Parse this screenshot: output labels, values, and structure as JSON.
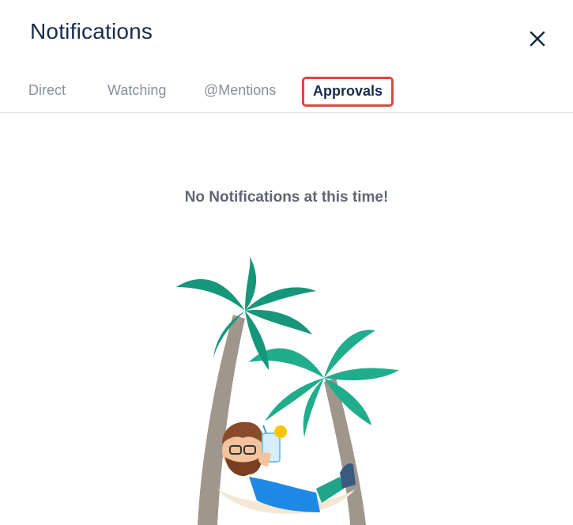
{
  "header": {
    "title": "Notifications",
    "close_icon": "close-icon"
  },
  "tabs": [
    {
      "label": "Direct",
      "active": false
    },
    {
      "label": "Watching",
      "active": false
    },
    {
      "label": "@Mentions",
      "active": false
    },
    {
      "label": "Approvals",
      "active": true
    }
  ],
  "empty_state": {
    "message": "No Notifications at this time!",
    "illustration_icon": "palm-trees-hammock-illustration"
  },
  "colors": {
    "title": "#172b4d",
    "tab_inactive": "#8a8f98",
    "highlight_border": "#e04545",
    "message": "#5e6673",
    "palm_leaf": "#1fad8c",
    "palm_trunk": "#a0968c"
  }
}
